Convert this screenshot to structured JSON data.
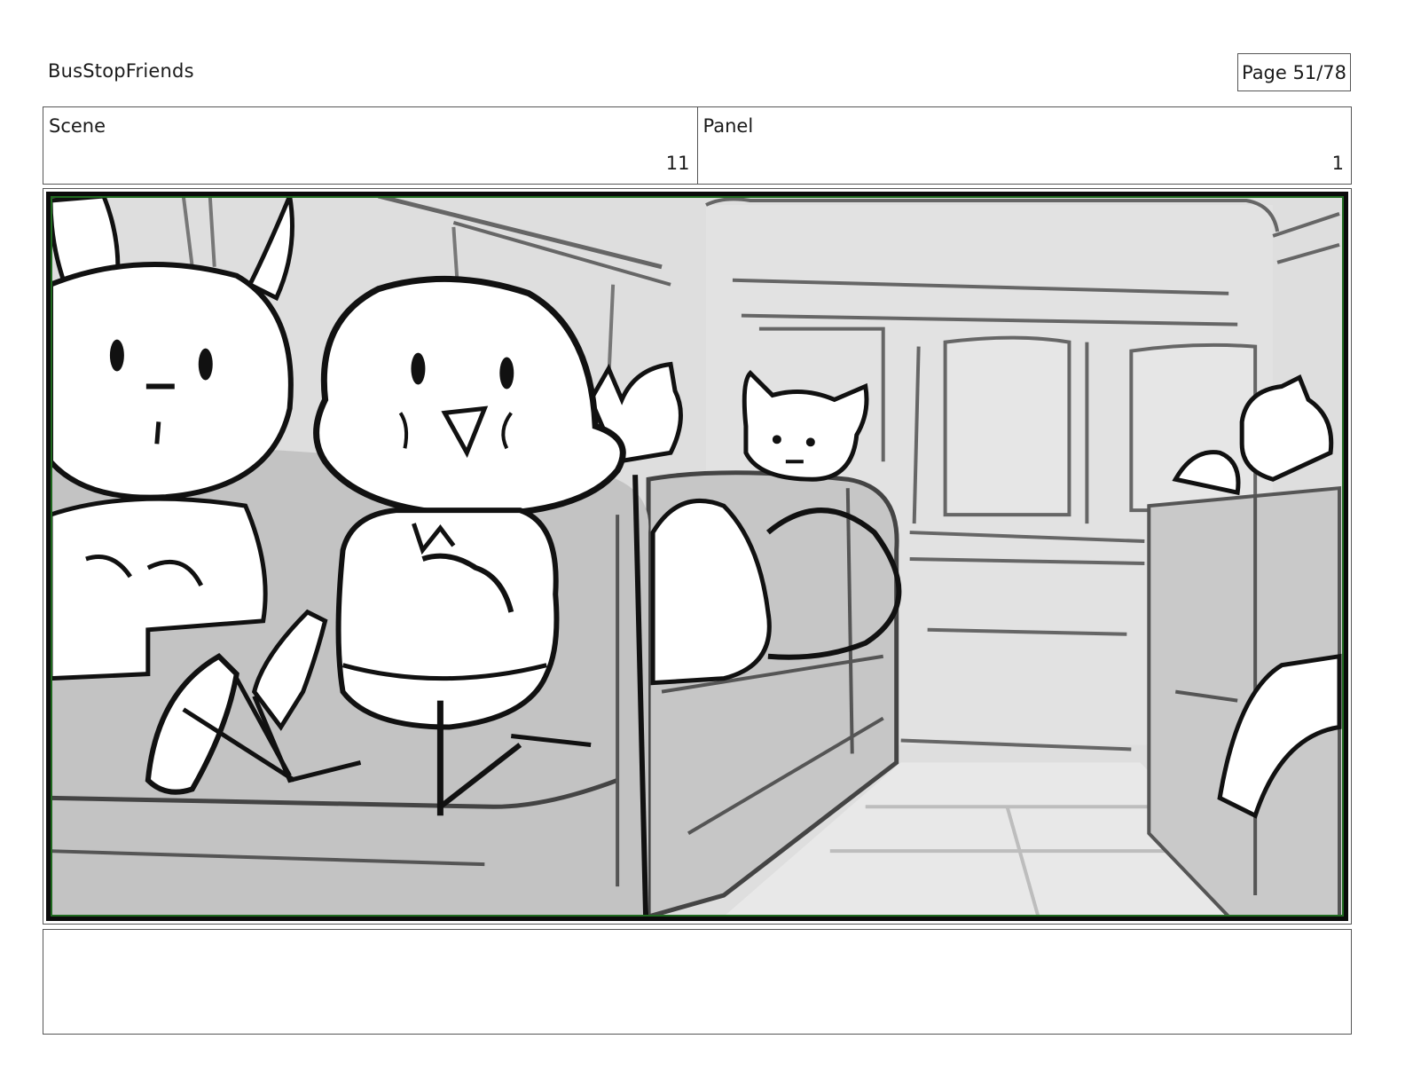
{
  "header": {
    "project_title": "BusStopFriends",
    "page_indicator": "Page 51/78"
  },
  "info": {
    "scene_label": "Scene",
    "scene_value": "11",
    "panel_label": "Panel",
    "panel_value": "1"
  },
  "frame": {
    "frame_border_color": "#1f6a1f"
  },
  "notes": {
    "text": ""
  }
}
